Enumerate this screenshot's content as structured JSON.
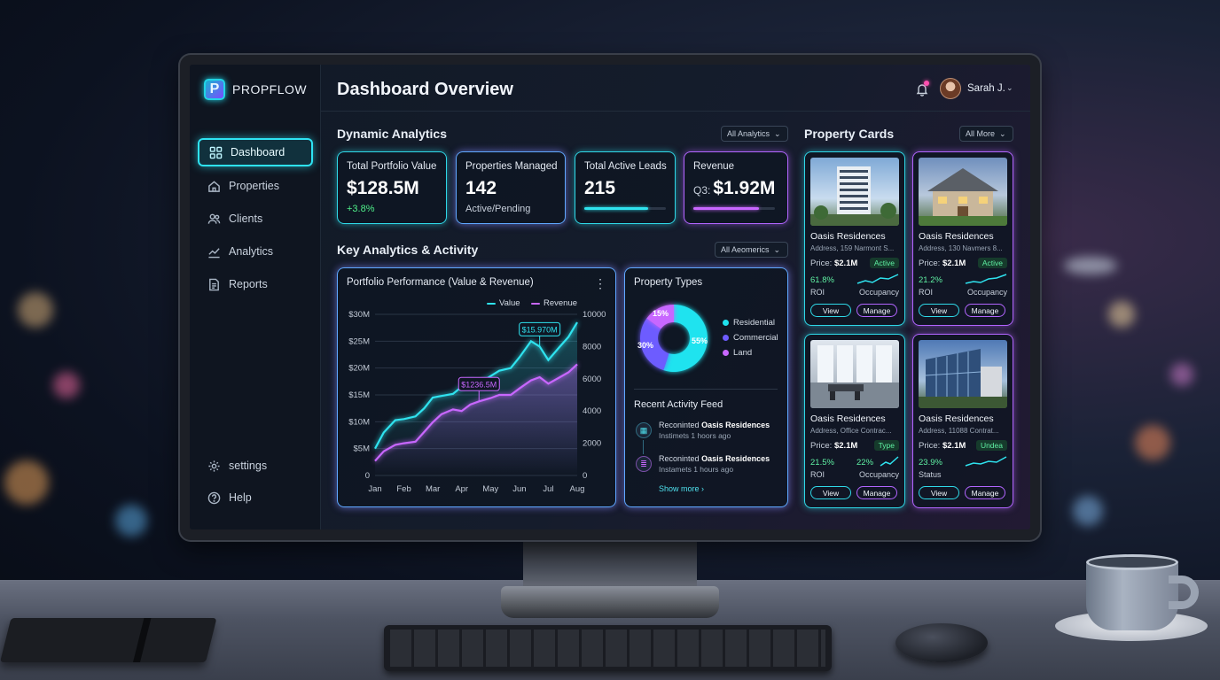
{
  "app": {
    "name": "PROPFLOW",
    "logo_letter": "P"
  },
  "sidebar": {
    "items": [
      {
        "label": "Dashboard",
        "icon": "grid-icon",
        "active": true
      },
      {
        "label": "Properties",
        "icon": "home-icon"
      },
      {
        "label": "Clients",
        "icon": "users-icon"
      },
      {
        "label": "Analytics",
        "icon": "trend-icon"
      },
      {
        "label": "Reports",
        "icon": "document-icon"
      }
    ],
    "bottom": [
      {
        "label": "settings",
        "icon": "gear-icon"
      },
      {
        "label": "Help",
        "icon": "help-icon"
      }
    ]
  },
  "header": {
    "title": "Dashboard Overview",
    "user_name": "Sarah J.",
    "user_chevron": "⌄"
  },
  "dynamic_analytics": {
    "title": "Dynamic Analytics",
    "filter": "All Analytics",
    "kpis": [
      {
        "label": "Total Portfolio Value",
        "value": "$128.5M",
        "sub": "+3.8%"
      },
      {
        "label": "Properties Managed",
        "value": "142",
        "sub": "Active/Pending"
      },
      {
        "label": "Total Active Leads",
        "value": "215",
        "progress": 0.78
      },
      {
        "label": "Revenue",
        "prefix": "Q3:",
        "value": "$1.92M",
        "progress": 0.8
      }
    ]
  },
  "key_analytics": {
    "title": "Key Analytics & Activity",
    "filter": "All Aeomerics"
  },
  "chart_data": {
    "type": "line",
    "title": "Portfolio Performance (Value & Revenue)",
    "categories": [
      "Jan",
      "Feb",
      "Mar",
      "Apr",
      "May",
      "Jun",
      "Jul",
      "Aug"
    ],
    "y_left_ticks": [
      "$30M",
      "$25M",
      "$20M",
      "$15M",
      "$10M",
      "$5M",
      "0"
    ],
    "y_right_ticks": [
      "10000",
      "8000",
      "6000",
      "4000",
      "2000",
      "0"
    ],
    "ylim_left": [
      0,
      30
    ],
    "ylim_right": [
      0,
      10000
    ],
    "series": [
      {
        "name": "Value",
        "color": "#2fe3ef",
        "axis": "left",
        "x": [
          0,
          0.3,
          0.7,
          1,
          1.4,
          1.7,
          2,
          2.3,
          2.7,
          3,
          3.3,
          3.6,
          4,
          4.3,
          4.7,
          5,
          5.4,
          5.7,
          6,
          6.4,
          6.7,
          7
        ],
        "values": [
          5,
          8,
          10.3,
          10.5,
          11,
          12.5,
          14.5,
          14.8,
          15.2,
          16.5,
          17.6,
          17.2,
          18.5,
          19.5,
          20,
          22,
          25,
          24,
          21.5,
          24,
          25.8,
          28.5
        ]
      },
      {
        "name": "Revenue",
        "color": "#c867ff",
        "axis": "right",
        "x": [
          0,
          0.3,
          0.7,
          1,
          1.4,
          1.7,
          2,
          2.3,
          2.7,
          3,
          3.3,
          3.6,
          4,
          4.3,
          4.7,
          5,
          5.4,
          5.7,
          6,
          6.4,
          6.7,
          7
        ],
        "values": [
          900,
          1500,
          1900,
          2000,
          2100,
          2700,
          3300,
          3800,
          4100,
          4000,
          4400,
          4600,
          4800,
          5000,
          5000,
          5400,
          5900,
          6100,
          5700,
          6100,
          6400,
          6900
        ]
      }
    ],
    "annotations": [
      {
        "text": "$1236.5M",
        "color": "#c867ff"
      },
      {
        "text": "$15.970M",
        "color": "#2fe3ef"
      }
    ],
    "legend": "top-right"
  },
  "property_types": {
    "title": "Property Types",
    "slices": [
      {
        "label": "Residential",
        "value": 55,
        "text": "55%",
        "color": "#1fe3ef"
      },
      {
        "label": "Commercial",
        "value": 30,
        "text": "30%",
        "color": "#6d5cff"
      },
      {
        "label": "Land",
        "value": 15,
        "text": "15%",
        "color": "#c867ff"
      }
    ]
  },
  "activity": {
    "title": "Recent Activity Feed",
    "items": [
      {
        "action": "Reconinted",
        "subject": "Oasis Residences",
        "time": "Instimets 1 hoors ago",
        "icon": "calendar-icon"
      },
      {
        "action": "Reconinted",
        "subject": "Oasis Residences",
        "time": "Instamets 1 hours ago",
        "icon": "database-icon"
      }
    ],
    "show_more": "Show more ›"
  },
  "property_cards": {
    "title": "Property Cards",
    "filter": "All More",
    "cards": [
      {
        "name": "Oasis Residences",
        "address": "Address, 159 Narmont S...",
        "price_label": "Price:",
        "price": "$2.1M",
        "badge": "Active",
        "roi": "61.8%",
        "roi_label": "ROI",
        "occ_value": "",
        "occ_label": "Occupancy",
        "view": "View",
        "manage": "Manage",
        "image": "tower-icon",
        "accent": "#2fd9e8"
      },
      {
        "name": "Oasis Residences",
        "address": "Address, 130 Navmers 8...",
        "price_label": "Price:",
        "price": "$2.1M",
        "badge": "Active",
        "roi": "21.2%",
        "roi_label": "ROI",
        "occ_value": "",
        "occ_label": "Occupancy",
        "view": "View",
        "manage": "Manage",
        "image": "house-icon",
        "accent": "#b265ff"
      },
      {
        "name": "Oasis Residences",
        "address": "Address, Office Contrac...",
        "price_label": "Price:",
        "price": "$2.1M",
        "badge": "Type",
        "roi": "21.5%",
        "roi_label": "ROI",
        "occ_value": "22%",
        "occ_label": "Occupancy",
        "view": "View",
        "manage": "Manage",
        "image": "office-icon",
        "accent": "#2fd9e8"
      },
      {
        "name": "Oasis Residences",
        "address": "Address, 11088 Contrat...",
        "price_label": "Price:",
        "price": "$2.1M",
        "badge": "Undea",
        "roi": "23.9%",
        "roi_label": "Status",
        "occ_value": "",
        "occ_label": "",
        "view": "View",
        "manage": "Manage",
        "image": "glass-building-icon",
        "accent": "#b265ff"
      }
    ]
  }
}
